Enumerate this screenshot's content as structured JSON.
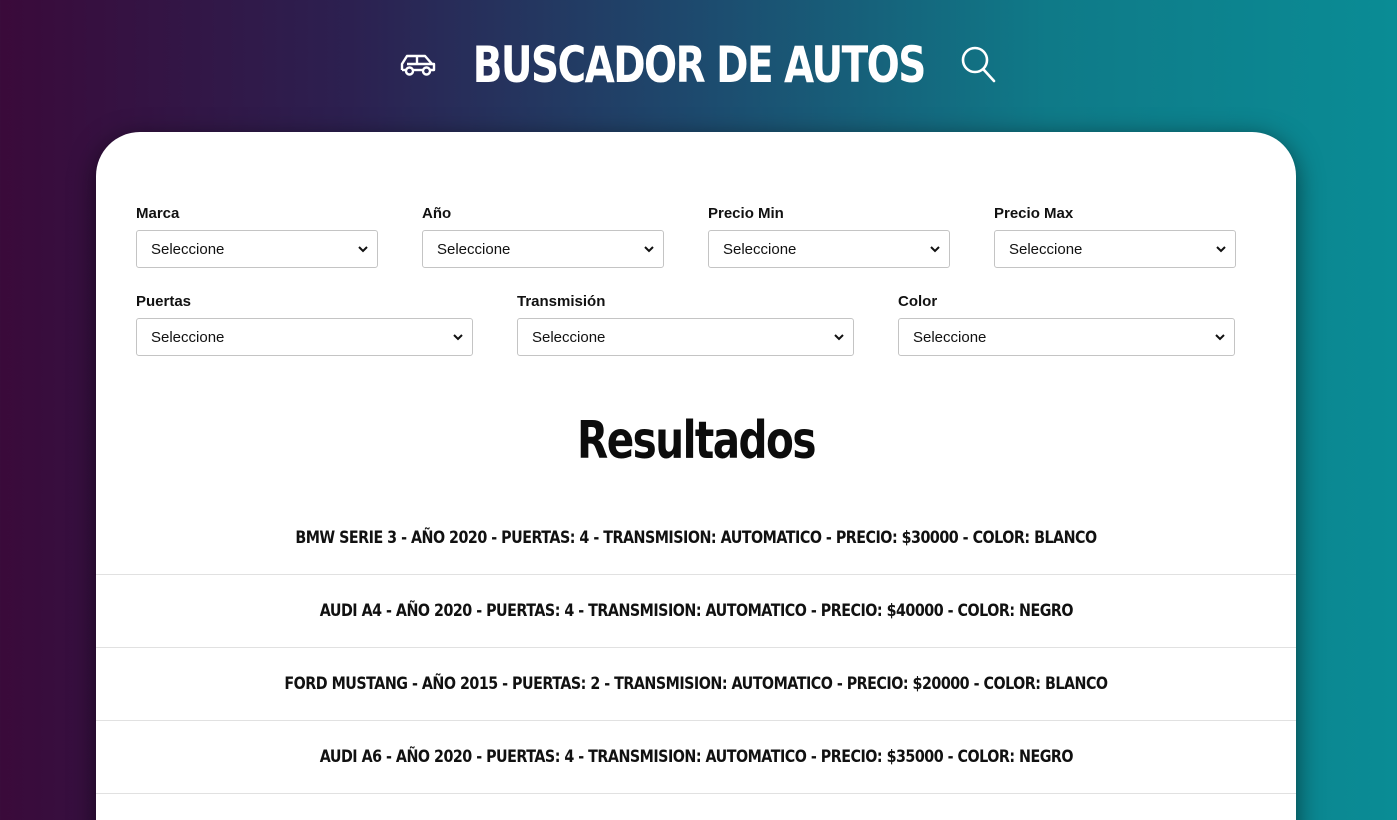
{
  "header": {
    "title": "Buscador de Autos",
    "left_icon": "car-icon",
    "right_icon": "search-icon"
  },
  "filters": {
    "row1": [
      {
        "label": "Marca",
        "value": "Seleccione"
      },
      {
        "label": "Año",
        "value": "Seleccione"
      },
      {
        "label": "Precio Min",
        "value": "Seleccione"
      },
      {
        "label": "Precio Max",
        "value": "Seleccione"
      }
    ],
    "row2": [
      {
        "label": "Puertas",
        "value": "Seleccione"
      },
      {
        "label": "Transmisión",
        "value": "Seleccione"
      },
      {
        "label": "Color",
        "value": "Seleccione"
      }
    ]
  },
  "results": {
    "title": "Resultados",
    "items": [
      "BMW Serie 3 - Año 2020 - Puertas: 4 - Transmision: automatico - Precio: $30000 - Color: Blanco",
      "Audi A4 - Año 2020 - Puertas: 4 - Transmision: automatico - Precio: $40000 - Color: Negro",
      "Ford Mustang - Año 2015 - Puertas: 2 - Transmision: automatico - Precio: $20000 - Color: Blanco",
      "Audi A6 - Año 2020 - Puertas: 4 - Transmision: automatico - Precio: $35000 - Color: Negro"
    ]
  },
  "colors": {
    "gradient_left": "#3a0a3a",
    "gradient_right": "#0a8c95",
    "card": "#ffffff"
  }
}
